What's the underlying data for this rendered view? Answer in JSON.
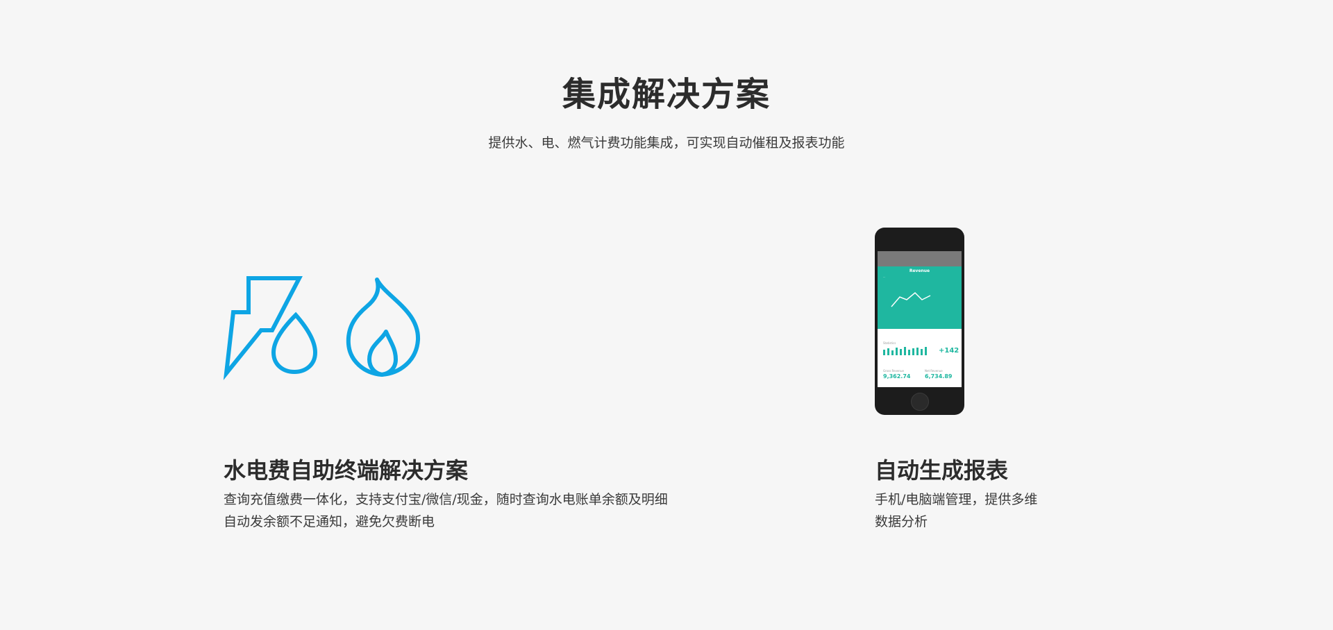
{
  "section": {
    "title": "集成解决方案",
    "subtitle": "提供水、电、燃气计费功能集成，可实现自动催租及报表功能"
  },
  "features": [
    {
      "icon": "utilities-icon",
      "title": "水电费自助终端解决方案",
      "lines": [
        "查询充值缴费一体化，支持支付宝/微信/现金，随时查询水电账单余额及明细",
        "自动发余额不足通知，避免欠费断电"
      ]
    },
    {
      "icon": "phone-report-image",
      "title": "自动生成报表",
      "lines": [
        "手机/电脑端管理，提供多维",
        "数据分析"
      ]
    }
  ],
  "phone": {
    "chart_title": "Revenue",
    "stat_label": "Statistics",
    "stat_delta": "+142",
    "left_label": "Gross Revenue",
    "left_value": "9,362.74",
    "right_label": "Net Revenue",
    "right_value": "6,734.89"
  },
  "colors": {
    "icon_blue": "#0ea5e4",
    "accent_teal": "#1fb7a0",
    "background": "#f6f6f6"
  }
}
